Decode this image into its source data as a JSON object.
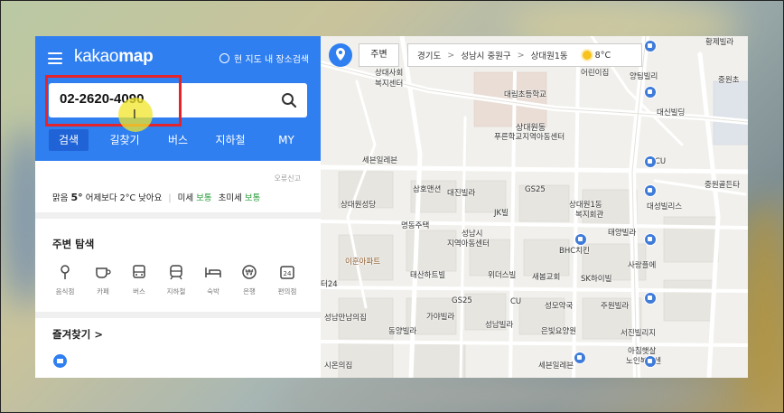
{
  "app": {
    "logo_light": "kakao",
    "logo_bold": "map",
    "region_search_label": "현 지도 내 장소검색"
  },
  "search": {
    "value": "02-2620-4090"
  },
  "tabs": [
    {
      "label": "검색"
    },
    {
      "label": "길찾기"
    },
    {
      "label": "버스"
    },
    {
      "label": "지하철"
    },
    {
      "label": "MY"
    }
  ],
  "report_label": "오류신고",
  "weather": {
    "condition": "맑음",
    "temp": "5°",
    "compare": "어제보다 2°C 낮아요",
    "fine_dust_label": "미세",
    "fine_dust_value": "보통",
    "ultra_fine_label": "초미세",
    "ultra_fine_value": "보통"
  },
  "nearby": {
    "title": "주변 탐색",
    "categories": [
      {
        "label": "음식점",
        "icon": "restaurant-icon"
      },
      {
        "label": "카페",
        "icon": "cafe-icon"
      },
      {
        "label": "버스",
        "icon": "bus-icon"
      },
      {
        "label": "지하철",
        "icon": "subway-icon"
      },
      {
        "label": "숙박",
        "icon": "bed-icon"
      },
      {
        "label": "은행",
        "icon": "bank-icon"
      },
      {
        "label": "편의점",
        "icon": "convenience-store-icon"
      }
    ]
  },
  "favorites": {
    "title": "즐겨찾기 >"
  },
  "map": {
    "nearby_label": "주변",
    "breadcrumb": [
      "경기도",
      "성남시 중원구",
      "상대원1동"
    ],
    "temperature": "8°C",
    "labels": [
      {
        "text": "상대사회",
        "key": "l1"
      },
      {
        "text": "복지센터",
        "key": "l2"
      },
      {
        "text": "대림초등학교",
        "key": "l3"
      },
      {
        "text": "어린이집",
        "key": "l4"
      },
      {
        "text": "양팀빌리",
        "key": "l5"
      },
      {
        "text": "중원초",
        "key": "l6"
      },
      {
        "text": "대신빌딩",
        "key": "l7"
      },
      {
        "text": "상대원동",
        "key": "l8"
      },
      {
        "text": "푸른학교지역아동센터",
        "key": "l9"
      },
      {
        "text": "세븐일레븐",
        "key": "l10"
      },
      {
        "text": "CU",
        "key": "l11"
      },
      {
        "text": "중원골든타",
        "key": "l12"
      },
      {
        "text": "삼호맨션",
        "key": "l13"
      },
      {
        "text": "대진빌라",
        "key": "l14"
      },
      {
        "text": "GS25",
        "key": "l15"
      },
      {
        "text": "상대원1동",
        "key": "l16"
      },
      {
        "text": "복지회관",
        "key": "l17"
      },
      {
        "text": "대성빌리스",
        "key": "l18"
      },
      {
        "text": "상대원성당",
        "key": "l19"
      },
      {
        "text": "JK빌",
        "key": "l20"
      },
      {
        "text": "명동주택",
        "key": "l21"
      },
      {
        "text": "태양빌라",
        "key": "l22"
      },
      {
        "text": "성남시",
        "key": "l23"
      },
      {
        "text": "지역아동센터",
        "key": "l24"
      },
      {
        "text": "BHC치킨",
        "key": "l25"
      },
      {
        "text": "이훈아파트",
        "key": "l26"
      },
      {
        "text": "사랑플에",
        "key": "l27"
      },
      {
        "text": "태산하트빌",
        "key": "l28"
      },
      {
        "text": "위더스빌",
        "key": "l29"
      },
      {
        "text": "새봄교회",
        "key": "l30"
      },
      {
        "text": "SK하이빌",
        "key": "l31"
      },
      {
        "text": "GS25",
        "key": "l32"
      },
      {
        "text": "CU",
        "key": "l33"
      },
      {
        "text": "성모약국",
        "key": "l34"
      },
      {
        "text": "주원빌라",
        "key": "l35"
      },
      {
        "text": "성남만남의집",
        "key": "l36"
      },
      {
        "text": "가야빌라",
        "key": "l37"
      },
      {
        "text": "성남빌라",
        "key": "l38"
      },
      {
        "text": "동양빌라",
        "key": "l39"
      },
      {
        "text": "은빛요양원",
        "key": "l40"
      },
      {
        "text": "서진빌리지",
        "key": "l41"
      },
      {
        "text": "세븐일레븐",
        "key": "l42"
      },
      {
        "text": "아침햇살",
        "key": "l43"
      },
      {
        "text": "노인복지센",
        "key": "l44"
      },
      {
        "text": "시온의집",
        "key": "l45"
      },
      {
        "text": "황제빌라",
        "key": "l46"
      },
      {
        "text": "터24",
        "key": "l47"
      }
    ]
  },
  "colors": {
    "brand_blue": "#2f7ff1",
    "active_tab": "#1f63d6",
    "highlight_red": "#e3242b",
    "status_green": "#2a9d3a"
  }
}
